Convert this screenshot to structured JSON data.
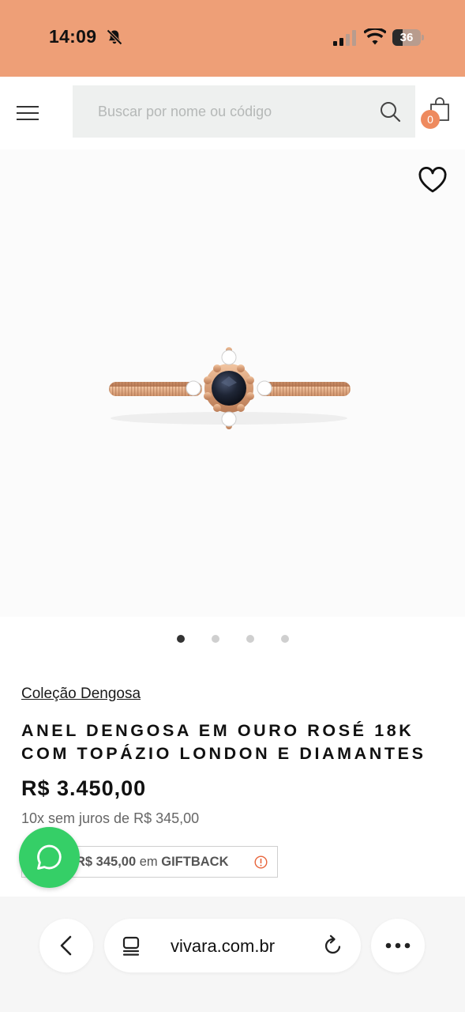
{
  "status_bar": {
    "time": "14:09",
    "battery_level": 36,
    "battery_label": "36",
    "bell_icon": "bell-slash-icon",
    "signal_icon": "cellular-signal-icon",
    "wifi_icon": "wifi-icon",
    "background_color": "#ee9f77"
  },
  "header": {
    "menu_icon": "hamburger-menu-icon",
    "search": {
      "placeholder": "Buscar por nome ou código",
      "value": ""
    },
    "search_icon": "search-icon",
    "bag_icon": "shopping-bag-icon",
    "bag_count": "0",
    "accent_color": "#ee8a5e"
  },
  "gallery": {
    "favorite_icon": "heart-icon",
    "image_alt": "ring-image",
    "slide_count": 4,
    "active_slide": 1
  },
  "product": {
    "collection_link": "Coleção Dengosa",
    "title_line1": "ANEL DENGOSA EM OURO ROSÉ 18K",
    "title_line2": "COM TOPÁZIO LONDON E DIAMANTES",
    "price": "R$ 3.450,00",
    "installments": "10x sem juros de R$ 345,00",
    "giftback_amount": "R$ 345,00",
    "giftback_word": "em",
    "giftback_label": "GIFTBACK",
    "info_icon": "info-icon"
  },
  "whatsapp": {
    "icon": "whatsapp-icon",
    "color": "#35cf67"
  },
  "browser": {
    "url": "vivara.com.br",
    "back_icon": "chevron-left-icon",
    "tabs_icon": "tabs-icon",
    "reload_icon": "reload-icon",
    "more_icon": "more-icon"
  }
}
